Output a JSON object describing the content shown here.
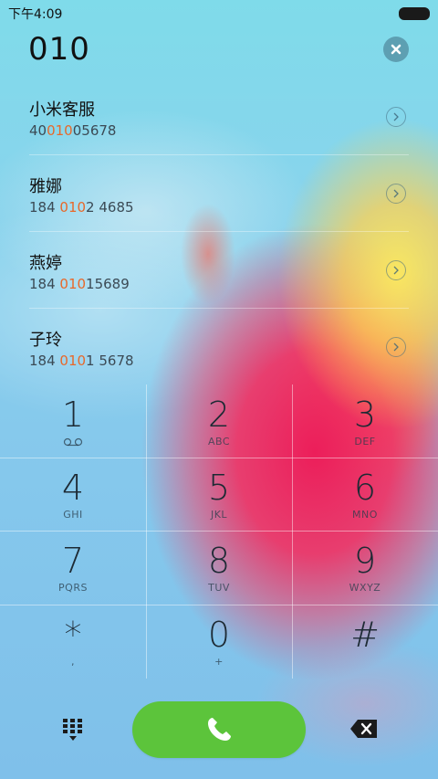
{
  "status_bar": {
    "time": "下午4:09"
  },
  "dialer": {
    "input_value": "010"
  },
  "contacts": [
    {
      "name": "小米客服",
      "phone_pre": "40",
      "phone_match": "010",
      "phone_post": "05678"
    },
    {
      "name": "雅娜",
      "phone_pre": "184 ",
      "phone_match": "010",
      "phone_post": "2 4685"
    },
    {
      "name": "燕婷",
      "phone_pre": "184 ",
      "phone_match": "010",
      "phone_post": "15689"
    },
    {
      "name": "子玲",
      "phone_pre": "184 ",
      "phone_match": "010",
      "phone_post": "1 5678"
    }
  ],
  "keypad": {
    "keys": [
      {
        "digit": "1",
        "letters": ""
      },
      {
        "digit": "2",
        "letters": "ABC"
      },
      {
        "digit": "3",
        "letters": "DEF"
      },
      {
        "digit": "4",
        "letters": "GHI"
      },
      {
        "digit": "5",
        "letters": "JKL"
      },
      {
        "digit": "6",
        "letters": "MNO"
      },
      {
        "digit": "7",
        "letters": "PQRS"
      },
      {
        "digit": "8",
        "letters": "TUV"
      },
      {
        "digit": "9",
        "letters": "WXYZ"
      },
      {
        "digit": "*",
        "letters": ","
      },
      {
        "digit": "0",
        "letters": "+"
      },
      {
        "digit": "#",
        "letters": ""
      }
    ]
  },
  "icons": {
    "voicemail": "voicemail-icon",
    "clear": "clear-icon",
    "chevron": "chevron-right-icon",
    "keypad_toggle": "dialpad-icon",
    "call": "phone-icon",
    "backspace": "backspace-icon"
  },
  "colors": {
    "call_button": "#5cc43b",
    "match_highlight": "#e8682a"
  }
}
